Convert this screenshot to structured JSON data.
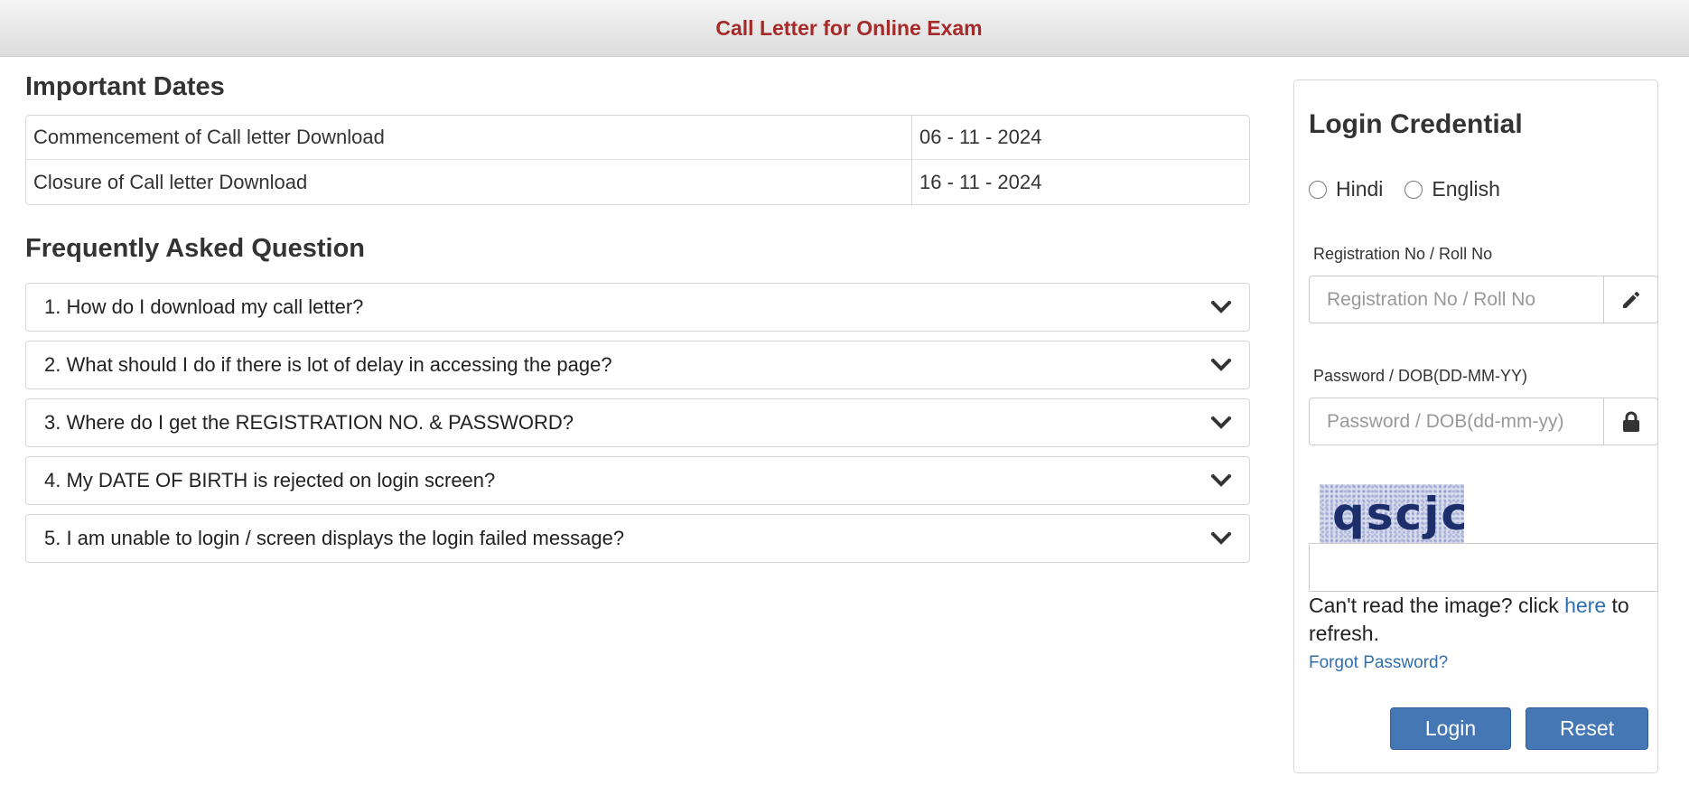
{
  "header": {
    "title": "Call Letter for Online Exam"
  },
  "important_dates": {
    "heading": "Important Dates",
    "rows": [
      {
        "label": "Commencement of Call letter Download",
        "date": "06 - 11 - 2024"
      },
      {
        "label": "Closure of Call letter Download",
        "date": "16 - 11 - 2024"
      }
    ]
  },
  "faq": {
    "heading": "Frequently Asked Question",
    "items": [
      "1. How do I download my call letter?",
      "2. What should I do if there is lot of delay in accessing the page?",
      "3. Where do I get the REGISTRATION NO. & PASSWORD?",
      "4. My DATE OF BIRTH is rejected on login screen?",
      "5. I am unable to login / screen displays the login failed message?"
    ],
    "icon": "chevron-down-icon"
  },
  "login": {
    "title": "Login Credential",
    "languages": [
      "Hindi",
      "English"
    ],
    "registration": {
      "label": "Registration No / Roll No",
      "placeholder": "Registration No / Roll No",
      "value": "",
      "icon": "pencil-icon"
    },
    "password": {
      "label": "Password / DOB(DD-MM-YY)",
      "placeholder": "Password / DOB(dd-mm-yy)",
      "value": "",
      "icon": "lock-icon"
    },
    "captcha": {
      "text": "qscjc",
      "input_value": "",
      "refresh_prefix": "Can't read the image? click ",
      "refresh_link": "here",
      "refresh_suffix": " to refresh."
    },
    "forgot_password": "Forgot Password?",
    "login_button": "Login",
    "reset_button": "Reset"
  },
  "colors": {
    "header_title": "#a52a2a",
    "button": "#4577b5",
    "link": "#2f6fb0"
  }
}
